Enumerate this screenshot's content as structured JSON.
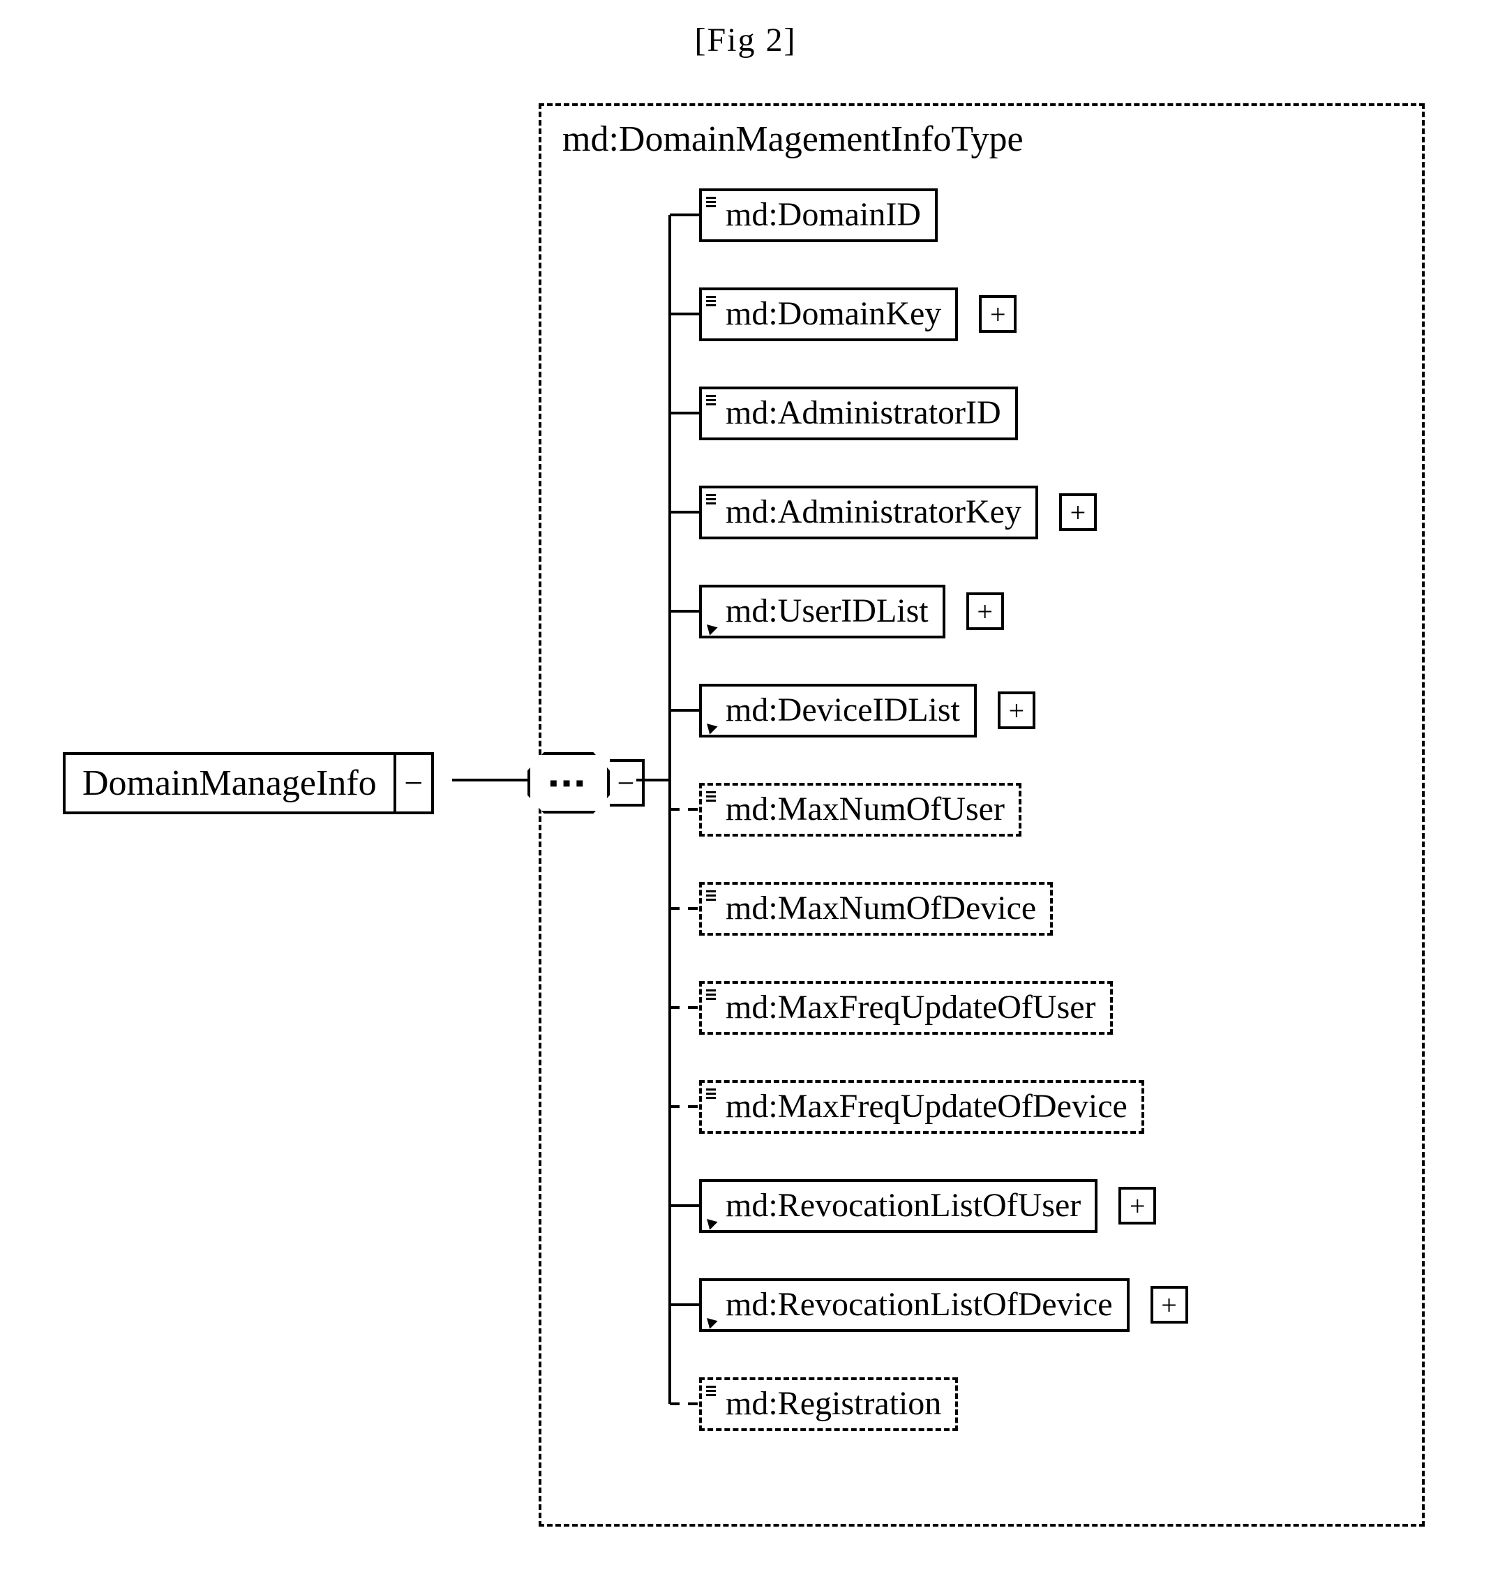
{
  "figure": {
    "caption": "[Fig 2]"
  },
  "root": {
    "label": "DomainManageInfo",
    "collapse_glyph": "−"
  },
  "compositor": {
    "glyph": "▪▪▪",
    "collapse_glyph": "−"
  },
  "type": {
    "title": "md:DomainMagementInfoType"
  },
  "plus_glyph": "+",
  "children": [
    {
      "label": "md:DomainID",
      "optional": false,
      "marker": "lines",
      "expandable": false
    },
    {
      "label": "md:DomainKey",
      "optional": false,
      "marker": "lines",
      "expandable": true
    },
    {
      "label": "md:AdministratorID",
      "optional": false,
      "marker": "lines",
      "expandable": false
    },
    {
      "label": "md:AdministratorKey",
      "optional": false,
      "marker": "lines",
      "expandable": true
    },
    {
      "label": "md:UserIDList",
      "optional": false,
      "marker": "arrow",
      "expandable": true
    },
    {
      "label": "md:DeviceIDList",
      "optional": false,
      "marker": "arrow",
      "expandable": true
    },
    {
      "label": "md:MaxNumOfUser",
      "optional": true,
      "marker": "lines",
      "expandable": false
    },
    {
      "label": "md:MaxNumOfDevice",
      "optional": true,
      "marker": "lines",
      "expandable": false
    },
    {
      "label": "md:MaxFreqUpdateOfUser",
      "optional": true,
      "marker": "lines",
      "expandable": false
    },
    {
      "label": "md:MaxFreqUpdateOfDevice",
      "optional": true,
      "marker": "lines",
      "expandable": false
    },
    {
      "label": "md:RevocationListOfUser",
      "optional": false,
      "marker": "arrow",
      "expandable": true
    },
    {
      "label": "md:RevocationListOfDevice",
      "optional": false,
      "marker": "arrow",
      "expandable": true
    },
    {
      "label": "md:Registration",
      "optional": true,
      "marker": "lines",
      "expandable": false
    }
  ]
}
